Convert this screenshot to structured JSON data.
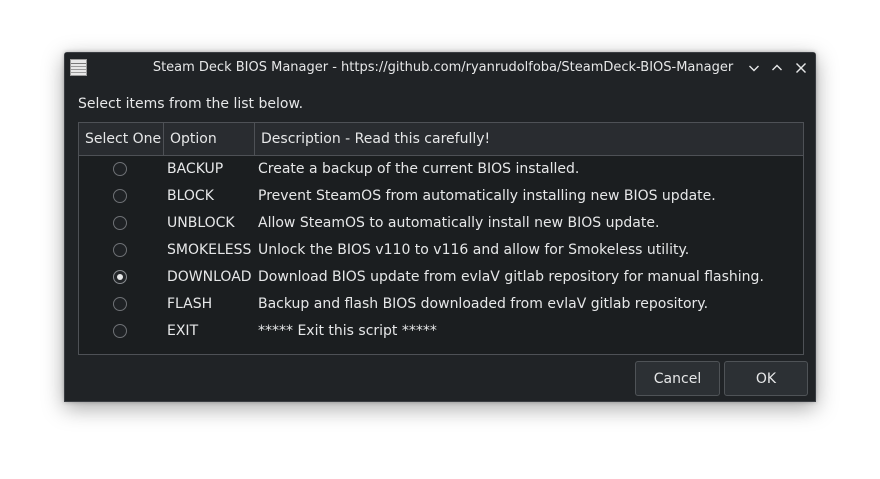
{
  "window": {
    "title": "Steam Deck BIOS Manager - https://github.com/ryanrudolfoba/SteamDeck-BIOS-Manager",
    "controls": [
      "minimize-icon",
      "maximize-icon",
      "close-icon"
    ]
  },
  "prompt": "Select items from the list below.",
  "table": {
    "columns": [
      "Select One",
      "Option",
      "Description - Read this carefully!"
    ],
    "rows": [
      {
        "selected": false,
        "option": "BACKUP",
        "description": "Create a backup of the current BIOS installed."
      },
      {
        "selected": false,
        "option": "BLOCK",
        "description": "Prevent SteamOS from automatically installing new BIOS update."
      },
      {
        "selected": false,
        "option": "UNBLOCK",
        "description": "Allow SteamOS to automatically install new BIOS update."
      },
      {
        "selected": false,
        "option": "SMOKELESS",
        "description": "Unlock the BIOS v110 to v116 and allow for Smokeless utility."
      },
      {
        "selected": true,
        "option": "DOWNLOAD",
        "description": "Download BIOS update from evlaV gitlab repository for manual flashing."
      },
      {
        "selected": false,
        "option": "FLASH",
        "description": "Backup and flash BIOS downloaded from evlaV gitlab repository."
      },
      {
        "selected": false,
        "option": "EXIT",
        "description": "***** Exit this script *****"
      }
    ]
  },
  "buttons": {
    "cancel": "Cancel",
    "ok": "OK"
  }
}
